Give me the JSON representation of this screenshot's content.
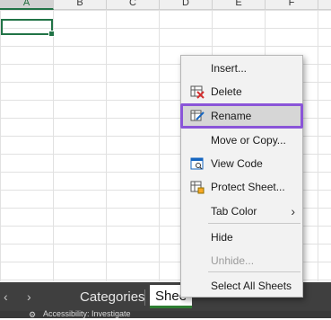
{
  "columns": [
    "A",
    "B",
    "C",
    "D",
    "E",
    "F"
  ],
  "tabs": {
    "prev_icon": "chevron-left-icon",
    "next_icon": "chevron-right-icon",
    "items": [
      {
        "label": "Categories"
      },
      {
        "label": "Shee"
      }
    ]
  },
  "status": {
    "text": "Accessibility: Investigate"
  },
  "context_menu": {
    "items": [
      {
        "label": "Insert...",
        "icon": ""
      },
      {
        "label": "Delete",
        "icon": "delete-sheet-icon"
      },
      {
        "label": "Rename",
        "icon": "rename-sheet-icon"
      },
      {
        "label": "Move or Copy...",
        "icon": ""
      },
      {
        "label": "View Code",
        "icon": "view-code-icon"
      },
      {
        "label": "Protect Sheet...",
        "icon": "protect-sheet-icon"
      },
      {
        "label": "Tab Color",
        "icon": "",
        "submenu": true
      },
      {
        "label": "Hide",
        "icon": ""
      },
      {
        "label": "Unhide...",
        "icon": "",
        "disabled": true
      },
      {
        "label": "Select All Sheets",
        "icon": ""
      }
    ],
    "highlighted": "Rename",
    "highlight_color": "#8a55d8"
  },
  "colors": {
    "excel_green": "#217346",
    "tabbar_bg": "#3f3f3f"
  }
}
